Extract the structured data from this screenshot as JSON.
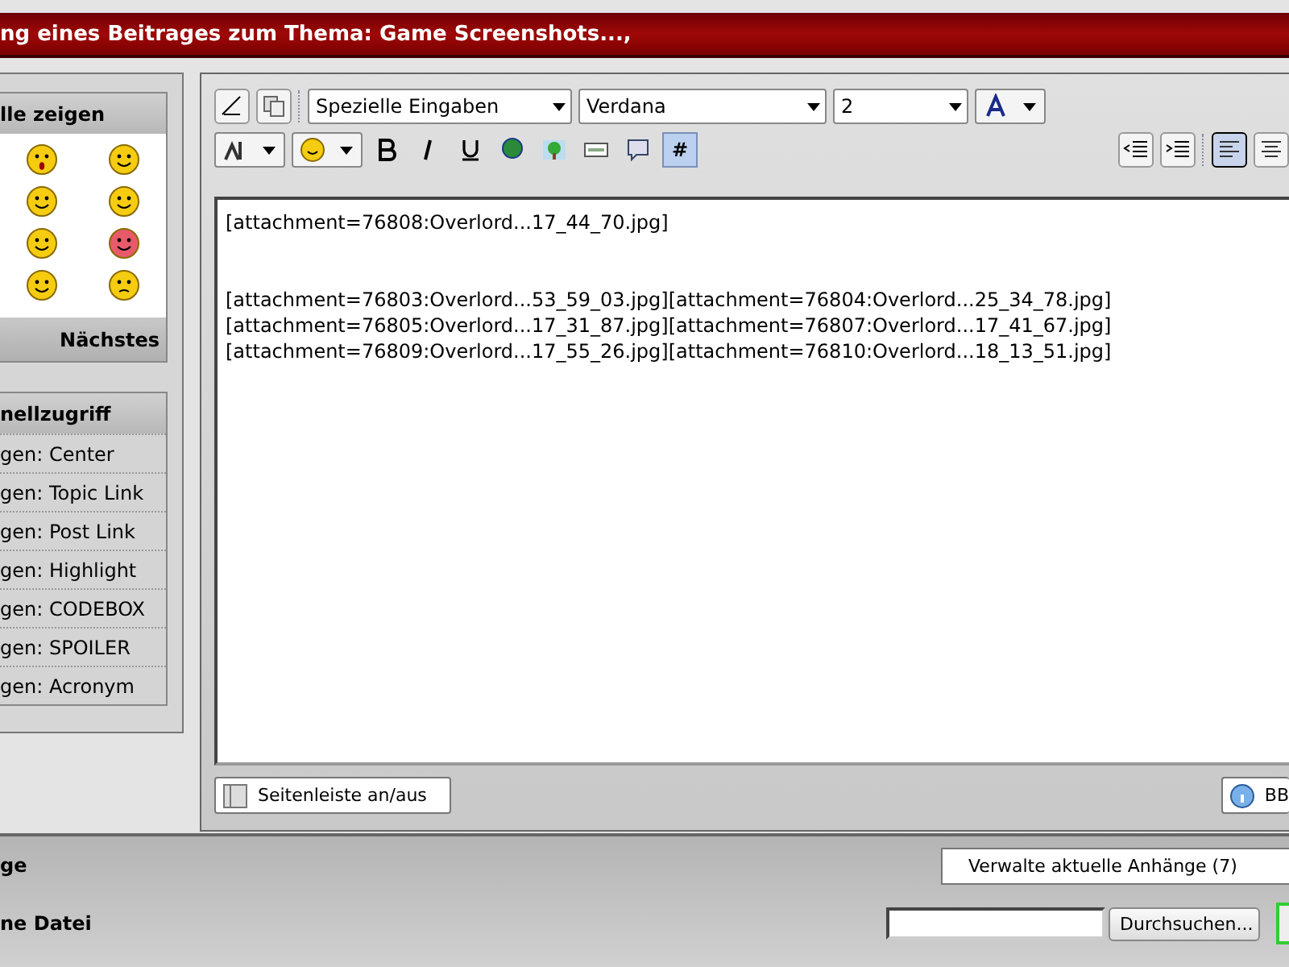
{
  "title_bar": {
    "title": "ng eines Beitrages zum Thema: Game Screenshots...,"
  },
  "sidebar": {
    "smilies": {
      "header": "lle zeigen",
      "next_link": "Nächstes"
    },
    "quick_access": {
      "header": "nellzugriff",
      "items": [
        "gen: Center",
        "gen: Topic Link",
        "gen: Post Link",
        "gen: Highlight",
        "gen: CODEBOX",
        "gen: SPOILER",
        "gen: Acronym"
      ]
    }
  },
  "toolbar": {
    "selects": [
      {
        "kind": "wide",
        "value": "Spezielle Eingaben"
      },
      {
        "kind": "wide",
        "value": "Verdana"
      },
      {
        "kind": "narrow",
        "value": "2"
      }
    ],
    "code_toggle": {
      "label": "#",
      "selected": true
    },
    "align_left": {
      "selected": true
    }
  },
  "editor": {
    "paragraphs": [
      [
        "[attachment=76808:Overlord...17_44_70.jpg]"
      ],
      [
        "[attachment=76803:Overlord...53_59_03.jpg][attachment=76804:Overlord...25_34_78.jpg]",
        "[attachment=76805:Overlord...17_31_87.jpg][attachment=76807:Overlord...17_41_67.jpg]",
        "[attachment=76809:Overlord...17_55_26.jpg][attachment=76810:Overlord...18_13_51.jpg]"
      ]
    ]
  },
  "editor_footer": {
    "sidebar_toggle": "Seitenleiste an/aus",
    "help_button": "BB"
  },
  "attachments": {
    "label": "ge",
    "manage_button": "Verwalte aktuelle Anhänge (7)",
    "file_label": "ne Datei",
    "browse_button": "Durchsuchen..."
  }
}
